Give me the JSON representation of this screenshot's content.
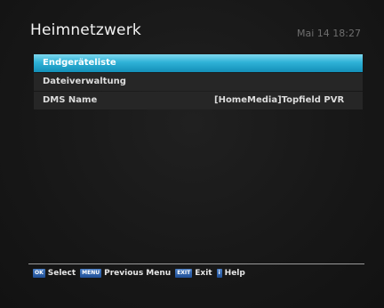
{
  "header": {
    "title": "Heimnetzwerk",
    "datetime": "Mai 14 18:27"
  },
  "menu": {
    "items": [
      {
        "label": "Endgeräteliste",
        "value": "",
        "selected": true
      },
      {
        "label": "Dateiverwaltung",
        "value": "",
        "selected": false
      },
      {
        "label": "DMS Name",
        "value": "[HomeMedia]Topfield PVR",
        "selected": false
      }
    ]
  },
  "footer": {
    "keys": [
      {
        "key": "OK",
        "label": "Select"
      },
      {
        "key": "MENU",
        "label": "Previous Menu"
      },
      {
        "key": "EXIT",
        "label": "Exit"
      },
      {
        "key": "i",
        "label": "Help"
      }
    ]
  },
  "colors": {
    "selected_bar": "#2fb2d7",
    "key_button": "#2f62ad",
    "background": "#1a1a1a"
  }
}
